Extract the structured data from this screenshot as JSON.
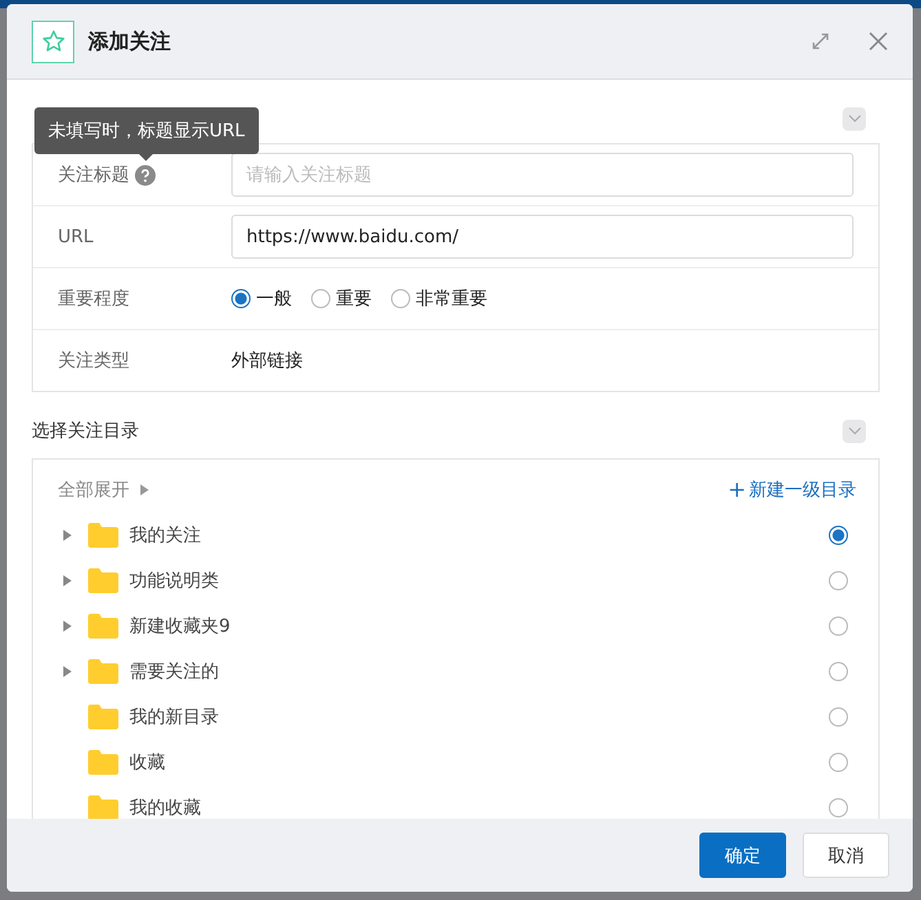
{
  "dialog": {
    "title": "添加关注"
  },
  "tooltip": "未填写时，标题显示URL",
  "form": {
    "rows": [
      {
        "kind": "input",
        "label": "关注标题",
        "help": true,
        "placeholder": "请输入关注标题"
      },
      {
        "kind": "input",
        "label": "URL",
        "help": false,
        "value": "https://www.baidu.com/"
      },
      {
        "kind": "radio",
        "label": "重要程度",
        "options": [
          {
            "label": "一般",
            "selected": true
          },
          {
            "label": "重要",
            "selected": false
          },
          {
            "label": "非常重要",
            "selected": false
          }
        ]
      },
      {
        "kind": "text",
        "label": "关注类型",
        "value": "外部链接"
      }
    ]
  },
  "directory": {
    "title": "选择关注目录",
    "expand_all": "全部展开",
    "new_root": "新建一级目录",
    "plus": "+",
    "items": [
      {
        "label": "我的关注",
        "expandable": true,
        "selected": true
      },
      {
        "label": "功能说明类",
        "expandable": true,
        "selected": false
      },
      {
        "label": "新建收藏夹9",
        "expandable": true,
        "selected": false
      },
      {
        "label": "需要关注的",
        "expandable": true,
        "selected": false
      },
      {
        "label": "我的新目录",
        "expandable": false,
        "selected": false
      },
      {
        "label": "收藏",
        "expandable": false,
        "selected": false
      },
      {
        "label": "我的收藏",
        "expandable": false,
        "selected": false
      }
    ]
  },
  "buttons": [
    {
      "label": "确定",
      "kind": "primary"
    },
    {
      "label": "取消",
      "kind": "secondary"
    }
  ]
}
